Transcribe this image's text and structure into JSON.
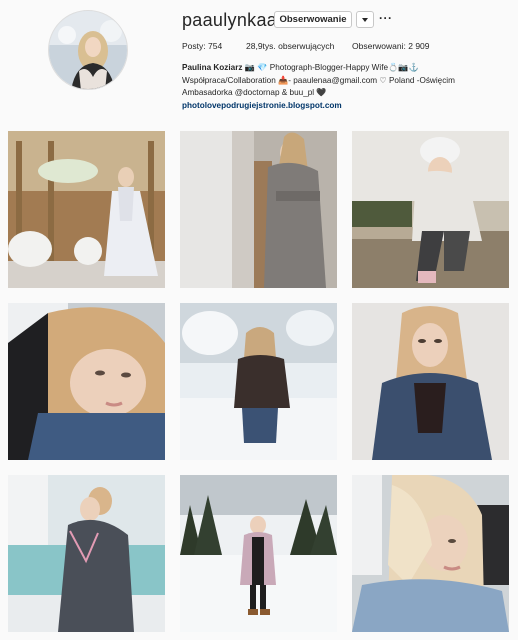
{
  "profile": {
    "username": "paaulynkaa",
    "follow_label": "Obserwowanie",
    "more_label": "···",
    "stats": {
      "posts_label": "Posty:",
      "posts_value": "754",
      "followers_value": "28,9tys.",
      "followers_label": "obserwujących",
      "following_label": "Obserwowani:",
      "following_value": "2 909"
    },
    "bio": {
      "name": "Paulina Koziarz",
      "line1_rest": "📷 💎 Photograph-Blogger-Happy Wife💍📷⚓",
      "line2": "Współpraca/Collaboration 📥- paaulenaa@gmail.com ♡ Poland -Oświęcim",
      "line3": "Ambasadorka @doctornap & buu_pl 🖤",
      "link": "photolovepodrugiejstronie.blogspot.com"
    }
  },
  "icons": [
    "dropdown-caret-icon",
    "more-options-icon"
  ],
  "posts": [
    {
      "id": "post-1",
      "palette": [
        "#c9b38f",
        "#e8e4e0",
        "#9a7a52"
      ]
    },
    {
      "id": "post-2",
      "palette": [
        "#d8d6d4",
        "#7f7b78",
        "#b9b3ab"
      ]
    },
    {
      "id": "post-3",
      "palette": [
        "#b7aa95",
        "#4a4a4a",
        "#e8e6e2"
      ]
    },
    {
      "id": "post-4",
      "palette": [
        "#c7cdd2",
        "#2c2c2c",
        "#d9b89a"
      ]
    },
    {
      "id": "post-5",
      "palette": [
        "#e9eef2",
        "#3a2f2c",
        "#c9a87e"
      ]
    },
    {
      "id": "post-6",
      "palette": [
        "#e6e4e2",
        "#3b4f6e",
        "#d8b48a"
      ]
    },
    {
      "id": "post-7",
      "palette": [
        "#dfe7ea",
        "#4a4f58",
        "#89c5c8"
      ]
    },
    {
      "id": "post-8",
      "palette": [
        "#eef1f3",
        "#2e3a2a",
        "#c0c7cc"
      ]
    },
    {
      "id": "post-9",
      "palette": [
        "#cfd4d7",
        "#8aa6c4",
        "#e9d6b8"
      ]
    }
  ]
}
